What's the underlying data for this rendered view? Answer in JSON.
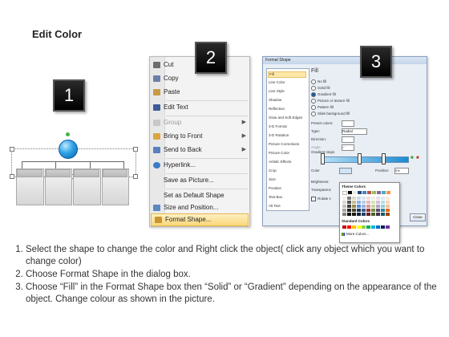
{
  "title": "Edit Color",
  "steps": {
    "one": "1",
    "two": "2",
    "three": "3"
  },
  "context_menu": {
    "items": [
      {
        "label": "Cut",
        "icon": "scissors-icon",
        "color": "#6c6c6c",
        "disabled": false,
        "submenu": false
      },
      {
        "label": "Copy",
        "icon": "copy-icon",
        "color": "#6a7fa8",
        "disabled": false,
        "submenu": false
      },
      {
        "label": "Paste",
        "icon": "paste-icon",
        "color": "#c99a45",
        "disabled": false,
        "submenu": false
      },
      {
        "label": "Edit Text",
        "icon": "edit-text-icon",
        "color": "#3c5d98",
        "disabled": false,
        "submenu": false
      },
      {
        "label": "Group",
        "icon": "group-icon",
        "color": "#b0b0b0",
        "disabled": true,
        "submenu": true
      },
      {
        "label": "Bring to Front",
        "icon": "bring-to-front-icon",
        "color": "#d9a640",
        "disabled": false,
        "submenu": true
      },
      {
        "label": "Send to Back",
        "icon": "send-to-back-icon",
        "color": "#5a7fc0",
        "disabled": false,
        "submenu": true
      },
      {
        "label": "Hyperlink...",
        "icon": "hyperlink-icon",
        "color": "#3b7bc4",
        "disabled": false,
        "submenu": false
      },
      {
        "label": "Save as Picture...",
        "icon": "",
        "color": "",
        "disabled": false,
        "submenu": false
      },
      {
        "label": "Set as Default Shape",
        "icon": "",
        "color": "",
        "disabled": false,
        "submenu": false
      },
      {
        "label": "Size and Position...",
        "icon": "size-position-icon",
        "color": "#5d87c0",
        "disabled": false,
        "submenu": false
      },
      {
        "label": "Format Shape...",
        "icon": "format-shape-icon",
        "color": "#c7962e",
        "disabled": false,
        "submenu": false,
        "highlighted": true
      }
    ]
  },
  "format_dialog": {
    "title": "Format Shape",
    "categories": [
      "Fill",
      "Line Color",
      "Line Style",
      "Shadow",
      "Reflection",
      "Glow and Soft Edges",
      "3-D Format",
      "3-D Rotation",
      "Picture Corrections",
      "Picture Color",
      "Artistic Effects",
      "Crop",
      "Size",
      "Position",
      "Text Box",
      "Alt Text"
    ],
    "pane_title": "Fill",
    "fill_options": [
      "No fill",
      "Solid fill",
      "Gradient fill",
      "Picture or texture fill",
      "Pattern fill",
      "Slide background fill"
    ],
    "selected_fill": "Gradient fill",
    "fields": {
      "preset_label": "Preset colors:",
      "type_label": "Type:",
      "type_value": "Radial",
      "direction_label": "Direction:",
      "angle_label": "Angle:",
      "angle_value": "0°",
      "stops_label": "Gradient stops",
      "color_label": "Color",
      "position_label": "Position:",
      "position_value": "0%",
      "brightness_label": "Brightness:",
      "transparency_label": "Transparenc",
      "rotate_label": "Rotate v"
    },
    "palette": {
      "theme_label": "Theme Colors",
      "standard_label": "Standard Colors",
      "more_label": "More Colors...",
      "theme_top": [
        "#ffffff",
        "#000000",
        "#eeece1",
        "#1f497d",
        "#4f81bd",
        "#c0504d",
        "#9bbb59",
        "#8064a2",
        "#4bacc6",
        "#f79646"
      ],
      "standard": [
        "#c00000",
        "#ff0000",
        "#ffc000",
        "#ffff00",
        "#92d050",
        "#00b050",
        "#00b0f0",
        "#0070c0",
        "#002060",
        "#7030a0"
      ]
    },
    "close_label": "Close"
  },
  "instructions": [
    "Select the shape to change the color and Right click the object( click any object which you want to change color)",
    "Choose Format Shape in the dialog box.",
    "Choose “Fill” in the Format Shape box then “Solid” or “Gradient” depending on the appearance of the object. Change colour as shown in the picture."
  ]
}
